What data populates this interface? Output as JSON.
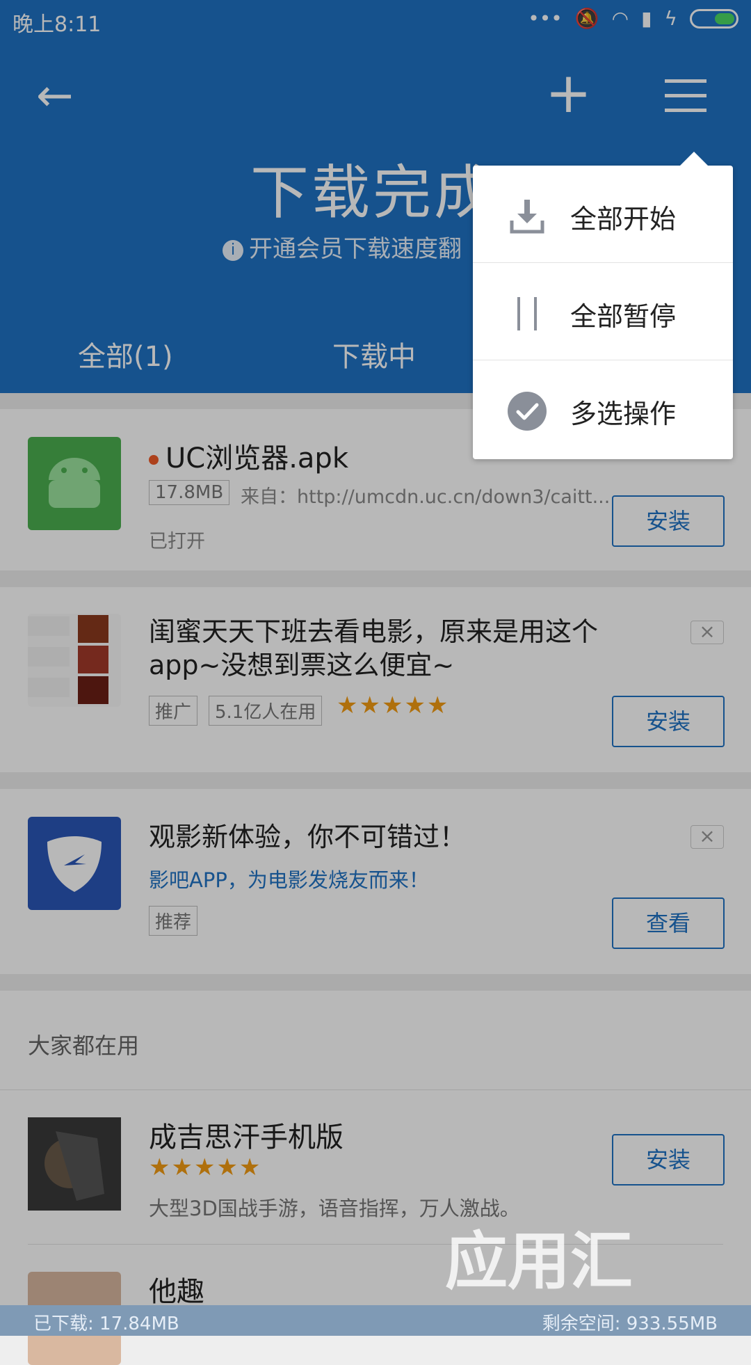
{
  "status": {
    "time": "晚上8:11"
  },
  "header": {
    "title": "下载完成",
    "subtitle": "开通会员下载速度翻"
  },
  "tabs": [
    {
      "label": "全部(1)"
    },
    {
      "label": "下载中"
    }
  ],
  "menu": {
    "items": [
      {
        "label": "全部开始"
      },
      {
        "label": "全部暂停"
      },
      {
        "label": "多选操作"
      }
    ]
  },
  "downloads": [
    {
      "name": "UC浏览器.apk",
      "size": "17.8MB",
      "source": "来自：http://umcdn.uc.cn/down3/caitt...",
      "status": "已打开",
      "button": "安装"
    }
  ],
  "promo1": {
    "title": "闺蜜天天下班去看电影，原来是用这个app~没想到票这么便宜~",
    "tag": "推广",
    "users": "5.1亿人在用",
    "button": "安装",
    "close": "×"
  },
  "promo2": {
    "title": "观影新体验，你不可错过！",
    "desc": "影吧APP，为电影发烧友而来！",
    "tag": "推荐",
    "button": "查看",
    "close": "×"
  },
  "section": {
    "title": "大家都在用"
  },
  "apps": [
    {
      "name": "成吉思汗手机版",
      "desc": "大型3D国战手游，语音指挥，万人激战。",
      "button": "安装"
    },
    {
      "name": "他趣"
    }
  ],
  "footer": {
    "downloaded": "已下载: 17.84MB",
    "space": "剩余空间: 933.55MB"
  },
  "watermark": "应用汇",
  "colors": {
    "primary": "#1f72c4",
    "accent": "#f39c12"
  }
}
